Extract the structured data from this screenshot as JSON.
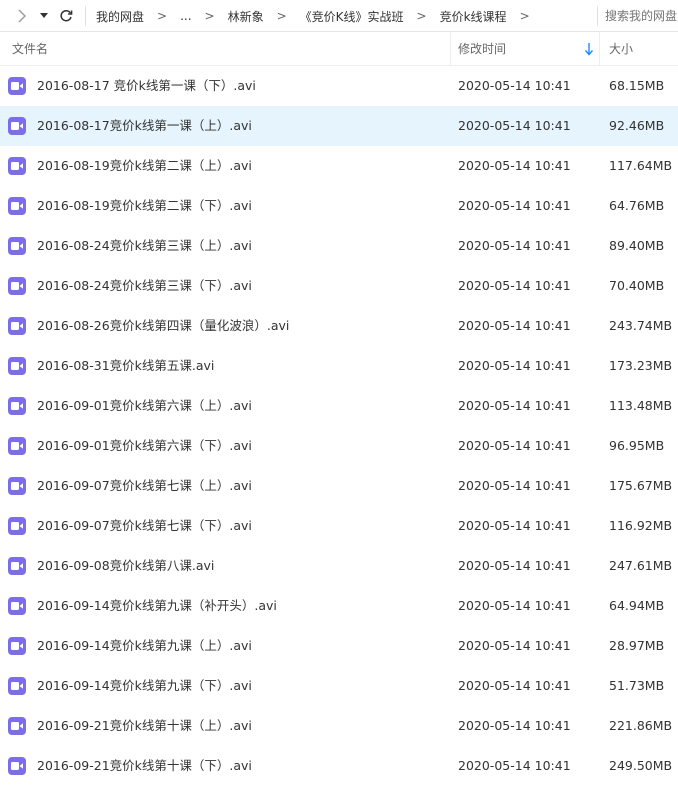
{
  "toolbar": {
    "breadcrumb": [
      "我的网盘",
      "...",
      "林新象",
      "《竞价K线》实战班",
      "竞价k线课程"
    ],
    "search_placeholder": "搜索我的网盘"
  },
  "columns": {
    "name": "文件名",
    "modified": "修改时间",
    "size": "大小"
  },
  "accent_color": "#1a8cff",
  "file_icon_color": "#7b6ee8",
  "selected_row_color": "#e6f4fd",
  "files": [
    {
      "name": "2016-08-17 竞价k线第一课（下）.avi",
      "modified": "2020-05-14 10:41",
      "size": "68.15MB"
    },
    {
      "name": "2016-08-17竞价k线第一课（上）.avi",
      "modified": "2020-05-14 10:41",
      "size": "92.46MB",
      "selected": true
    },
    {
      "name": "2016-08-19竞价k线第二课（上）.avi",
      "modified": "2020-05-14 10:41",
      "size": "117.64MB"
    },
    {
      "name": "2016-08-19竞价k线第二课（下）.avi",
      "modified": "2020-05-14 10:41",
      "size": "64.76MB"
    },
    {
      "name": "2016-08-24竞价k线第三课（上）.avi",
      "modified": "2020-05-14 10:41",
      "size": "89.40MB"
    },
    {
      "name": "2016-08-24竞价k线第三课（下）.avi",
      "modified": "2020-05-14 10:41",
      "size": "70.40MB"
    },
    {
      "name": "2016-08-26竞价k线第四课（量化波浪）.avi",
      "modified": "2020-05-14 10:41",
      "size": "243.74MB"
    },
    {
      "name": "2016-08-31竞价k线第五课.avi",
      "modified": "2020-05-14 10:41",
      "size": "173.23MB"
    },
    {
      "name": "2016-09-01竞价k线第六课（上）.avi",
      "modified": "2020-05-14 10:41",
      "size": "113.48MB"
    },
    {
      "name": "2016-09-01竞价k线第六课（下）.avi",
      "modified": "2020-05-14 10:41",
      "size": "96.95MB"
    },
    {
      "name": "2016-09-07竞价k线第七课（上）.avi",
      "modified": "2020-05-14 10:41",
      "size": "175.67MB"
    },
    {
      "name": "2016-09-07竞价k线第七课（下）.avi",
      "modified": "2020-05-14 10:41",
      "size": "116.92MB"
    },
    {
      "name": "2016-09-08竞价k线第八课.avi",
      "modified": "2020-05-14 10:41",
      "size": "247.61MB"
    },
    {
      "name": "2016-09-14竞价k线第九课（补开头）.avi",
      "modified": "2020-05-14 10:41",
      "size": "64.94MB"
    },
    {
      "name": "2016-09-14竞价k线第九课（上）.avi",
      "modified": "2020-05-14 10:41",
      "size": "28.97MB"
    },
    {
      "name": "2016-09-14竞价k线第九课（下）.avi",
      "modified": "2020-05-14 10:41",
      "size": "51.73MB"
    },
    {
      "name": "2016-09-21竞价k线第十课（上）.avi",
      "modified": "2020-05-14 10:41",
      "size": "221.86MB"
    },
    {
      "name": "2016-09-21竞价k线第十课（下）.avi",
      "modified": "2020-05-14 10:41",
      "size": "249.50MB"
    }
  ]
}
